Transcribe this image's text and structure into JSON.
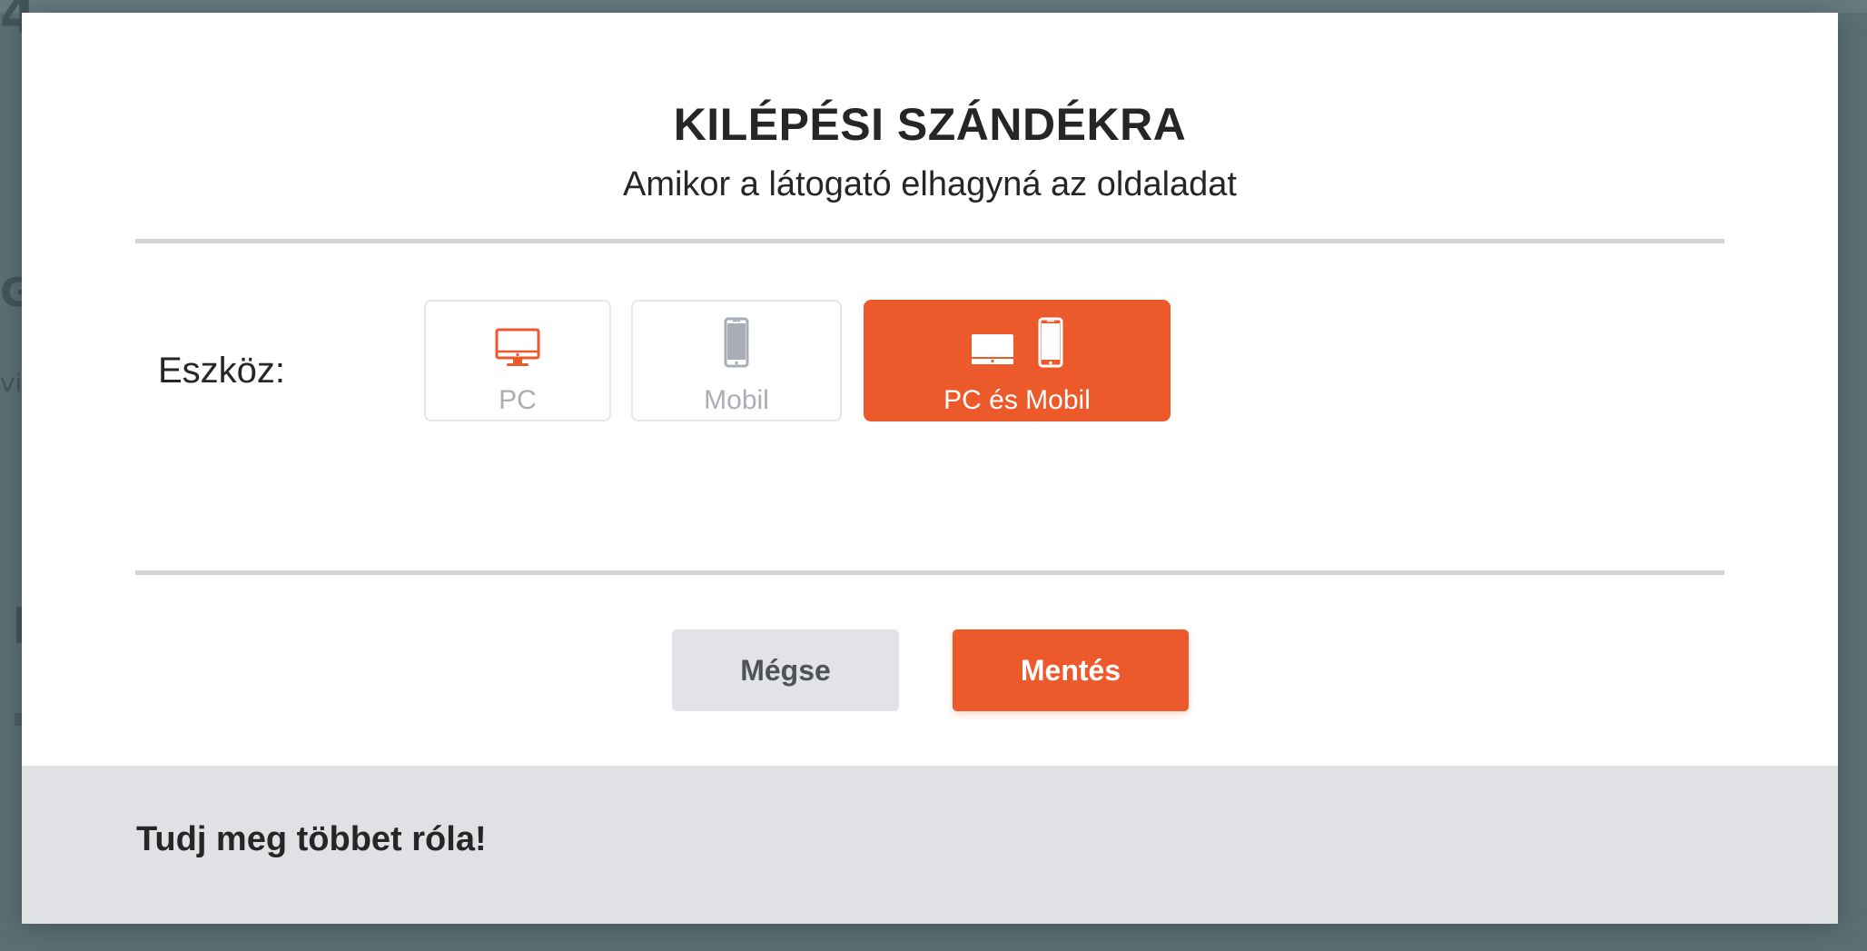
{
  "modal": {
    "title": "KILÉPÉSI SZÁNDÉKRA",
    "subtitle": "Amikor a látogató elhagyná az oldaladat"
  },
  "device": {
    "label": "Eszköz:",
    "selected": "PC és Mobil",
    "options": [
      {
        "label": "PC",
        "icon": "desktop-icon",
        "selected": false
      },
      {
        "label": "Mobil",
        "icon": "phone-icon",
        "selected": false
      },
      {
        "label": "PC és Mobil",
        "icon": "desktop-and-phone-icon",
        "selected": true
      }
    ]
  },
  "actions": {
    "cancel_label": "Mégse",
    "save_label": "Mentés"
  },
  "footer": {
    "link_text": "Tudj meg többet róla!"
  },
  "colors": {
    "accent": "#ec5a2c",
    "cancel_bg": "#e1e3e7",
    "footer_bg": "#e0e1e5",
    "divider": "#d4d4d4",
    "inactive_text": "#a9adb6"
  }
}
